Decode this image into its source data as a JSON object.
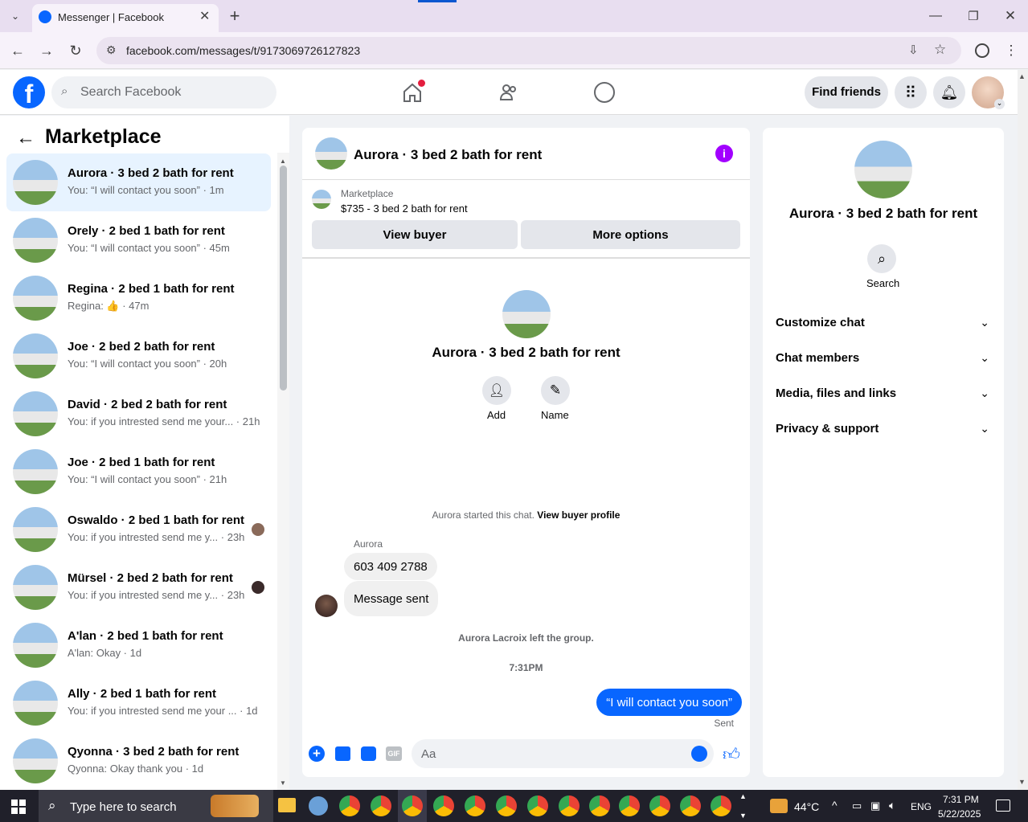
{
  "browser": {
    "tab_title": "Messenger | Facebook",
    "url": "facebook.com/messages/t/9173069726127823"
  },
  "fb": {
    "search_placeholder": "Search Facebook",
    "find_friends": "Find friends"
  },
  "sidebar": {
    "title": "Marketplace",
    "items": [
      {
        "title": "Aurora · 3 bed 2 bath for rent",
        "sub": "You: “I will contact you soon” · 1m"
      },
      {
        "title": "Orely · 2 bed 1 bath for rent",
        "sub": "You: “I will contact you soon” · 45m"
      },
      {
        "title": "Regina · 2 bed 1 bath for rent",
        "sub": "Regina: 👍 · 47m"
      },
      {
        "title": "Joe · 2 bed 2 bath for rent",
        "sub": "You: “I will contact you soon” · 20h"
      },
      {
        "title": "David · 2 bed 2 bath for rent",
        "sub": "You: if you intrested send me your... · 21h"
      },
      {
        "title": "Joe · 2 bed 1 bath for rent",
        "sub": "You: “I will contact you soon” · 21h"
      },
      {
        "title": "Oswaldo · 2 bed 1 bath for rent",
        "sub": "You: if you intrested send me y... · 23h"
      },
      {
        "title": "Mürsel · 2 bed 2 bath for rent",
        "sub": "You: if you intrested send me y... · 23h"
      },
      {
        "title": "A'lan · 2 bed 1 bath for rent",
        "sub": "A'lan: Okay · 1d"
      },
      {
        "title": "Ally · 2 bed 1 bath for rent",
        "sub": "You: if you intrested send me your ... · 1d"
      },
      {
        "title": "Qyonna · 3 bed 2 bath for rent",
        "sub": "Qyonna: Okay thank you · 1d"
      }
    ]
  },
  "chat": {
    "title": "Aurora · 3 bed 2 bath for rent",
    "listing_source": "Marketplace",
    "listing_price": "$735 - 3 bed 2 bath for rent",
    "view_buyer": "View buyer",
    "more_options": "More options",
    "center_title": "Aurora · 3 bed 2 bath for rent",
    "add_label": "Add",
    "name_label": "Name",
    "started_text": "Aurora started this chat.",
    "view_buyer_profile": "View buyer profile",
    "sender_name": "Aurora",
    "msg1": "603 409 2788",
    "msg2": "Message sent",
    "left_group": "Aurora Lacroix left the group.",
    "time": "7:31PM",
    "my_msg": "“I will contact you soon”",
    "sent_status": "Sent",
    "composer_placeholder": "Aa"
  },
  "info": {
    "title": "Aurora · 3 bed 2 bath for rent",
    "search_label": "Search",
    "sections": [
      "Customize chat",
      "Chat members",
      "Media, files and links",
      "Privacy & support"
    ]
  },
  "taskbar": {
    "search_placeholder": "Type here to search",
    "temperature": "44°C",
    "language": "ENG",
    "time": "7:31 PM",
    "date": "5/22/2025"
  }
}
